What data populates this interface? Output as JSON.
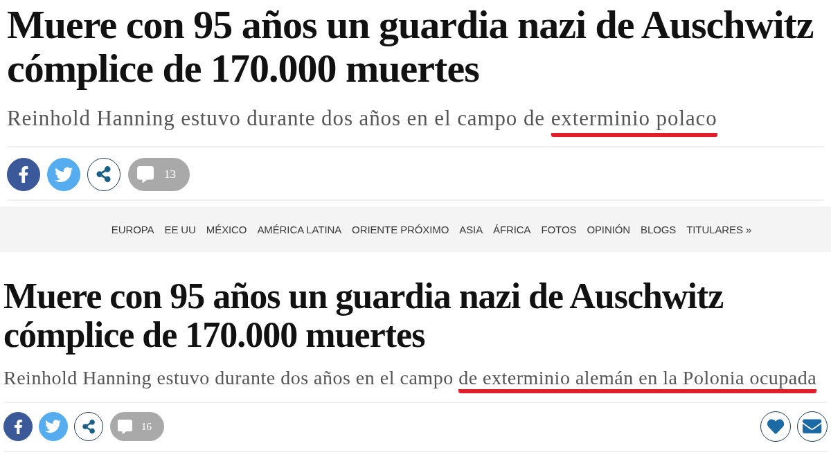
{
  "article_top": {
    "headline": "Muere con 95 años un guardia nazi de Auschwitz cómplice de 170.000 muertes",
    "subtitle": [
      {
        "text": "Reinhold Hanning estuvo durante dos años en el campo de",
        "underlined": false
      },
      {
        "text": "exterminio polaco",
        "underlined": true
      }
    ],
    "share_buttons": [
      {
        "kind": "facebook"
      },
      {
        "kind": "twitter"
      },
      {
        "kind": "share"
      }
    ],
    "comment_count": "13"
  },
  "section_nav": {
    "items": [
      "EUROPA",
      "EE UU",
      "MÉXICO",
      "AMÉRICA LATINA",
      "ORIENTE PRÓXIMO",
      "ASIA",
      "ÁFRICA",
      "FOTOS",
      "OPINIÓN",
      "BLOGS",
      "TITULARES »"
    ]
  },
  "article_bottom": {
    "headline": "Muere con 95 años un guardia nazi de Auschwitz cómplice de 170.000 muertes",
    "subtitle": [
      {
        "text": "Reinhold Hanning estuvo durante dos años en el campo",
        "underlined": false
      },
      {
        "text": "de exterminio alemán en la Polonia ocupada",
        "underlined": true
      }
    ],
    "share_buttons": [
      {
        "kind": "facebook"
      },
      {
        "kind": "twitter"
      },
      {
        "kind": "share"
      }
    ],
    "comment_count": "16",
    "side_buttons": [
      {
        "kind": "favorite"
      },
      {
        "kind": "email"
      }
    ]
  }
}
